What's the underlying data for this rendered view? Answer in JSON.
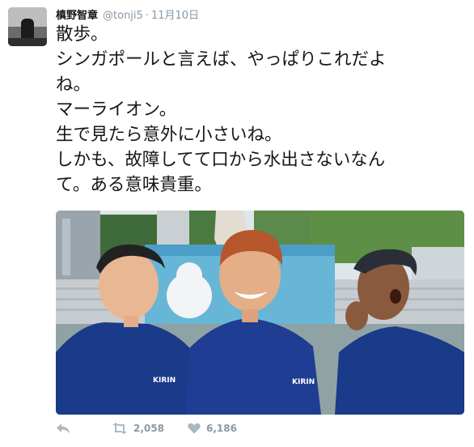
{
  "tweet": {
    "author_name": "槙野智章",
    "handle": "@tonji5",
    "separator": "·",
    "date": "11月10日",
    "lines": [
      "散歩。",
      "シンガポールと言えば、やっぱりこれだよ",
      "ね。",
      "マーライオン。",
      "生で見たら意外に小さいね。",
      "しかも、故障してて口から水出さないなん",
      "て。ある意味貴重。"
    ],
    "photo": {
      "jersey_text_left": "KIRIN",
      "jersey_text_center": "KIRIN"
    },
    "actions": {
      "reply_icon": "reply-icon",
      "retweet_icon": "retweet-icon",
      "retweet_count": "2,058",
      "like_icon": "heart-icon",
      "like_count": "6,186"
    }
  },
  "colors": {
    "text": "#14171a",
    "meta": "#8899a6",
    "jersey": "#1a3a8a"
  }
}
